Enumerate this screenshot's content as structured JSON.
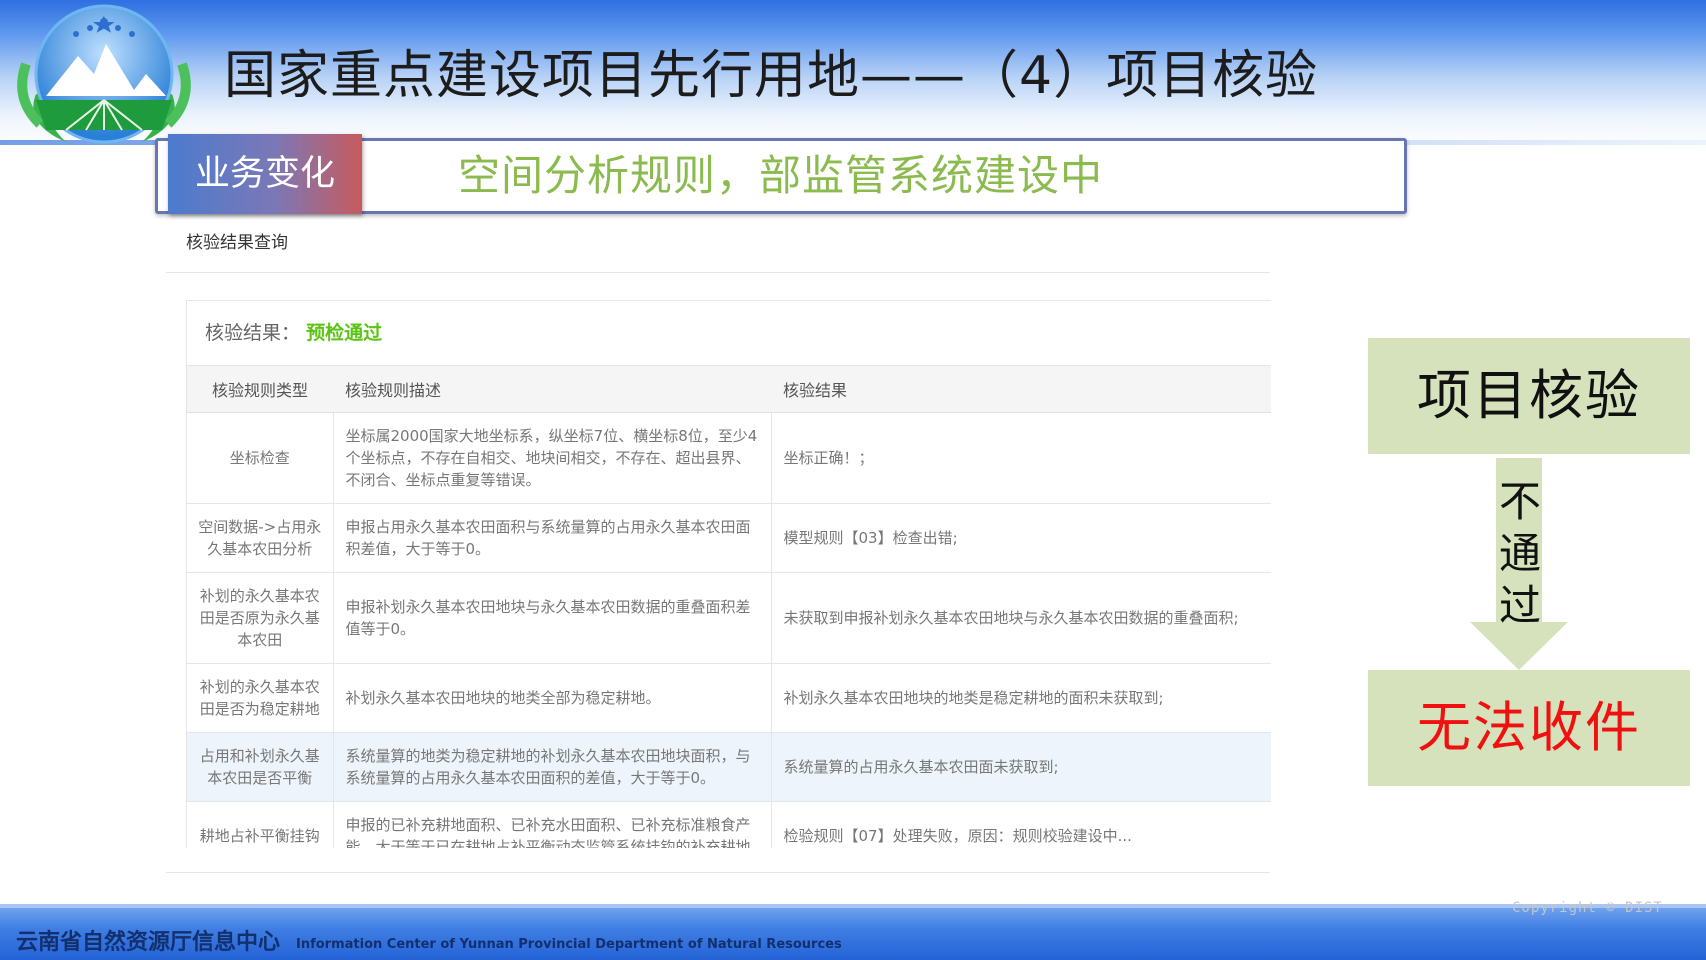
{
  "slide": {
    "title": "国家重点建设项目先行用地——（4）项目核验"
  },
  "banner": {
    "tag": "业务变化",
    "text": "空间分析规则，部监管系统建设中"
  },
  "screenshot": {
    "header": "核验结果查询",
    "result_label": "核验结果：",
    "result_value": "预检通过",
    "columns": [
      "核验规则类型",
      "核验规则描述",
      "核验结果"
    ],
    "rows": [
      {
        "type": "坐标检查",
        "desc": "坐标属2000国家大地坐标系，纵坐标7位、横坐标8位，至少4个坐标点，不存在自相交、地块间相交，不存在、超出县界、不闭合、坐标点重复等错误。",
        "result": "坐标正确！；"
      },
      {
        "type": "空间数据->占用永久基本农田分析",
        "desc": "申报占用永久基本农田面积与系统量算的占用永久基本农田面积差值，大于等于0。",
        "result": "模型规则【03】检查出错;"
      },
      {
        "type": "补划的永久基本农田是否原为永久基本农田",
        "desc": "申报补划永久基本农田地块与永久基本农田数据的重叠面积差值等于0。",
        "result": "未获取到申报补划永久基本农田地块与永久基本农田数据的重叠面积;"
      },
      {
        "type": "补划的永久基本农田是否为稳定耕地",
        "desc": "补划永久基本农田地块的地类全部为稳定耕地。",
        "result": "补划永久基本农田地块的地类是稳定耕地的面积未获取到;"
      },
      {
        "type": "占用和补划永久基本农田是否平衡",
        "desc": "系统量算的地类为稳定耕地的补划永久基本农田地块面积，与系统量算的占用永久基本农田面积的差值，大于等于0。",
        "result": "系统量算的占用永久基本农田面未获取到;"
      },
      {
        "type": "耕地占补平衡挂钩",
        "desc": "申报的已补充耕地面积、已补充水田面积、已补充标准粮食产能，大于等于已在耕地占补平衡动态监管系统挂钩的补充耕地",
        "result": "检验规则【07】处理失败，原因：规则校验建设中..."
      }
    ]
  },
  "flow": {
    "top_box": "项目核验",
    "arrow_label": [
      "不",
      "通",
      "过"
    ],
    "bottom_box": "无法收件"
  },
  "footer": {
    "cn": "云南省自然资源厅信息中心",
    "en": "Information Center  of Yunnan Provincial Department of Natural Resources",
    "copyright": "Copyright © DIST"
  },
  "colors": {
    "banner_text": "#8bba4f",
    "result_ok": "#5cc414",
    "box_fill": "#d5e2bc",
    "warning": "#f01010"
  }
}
